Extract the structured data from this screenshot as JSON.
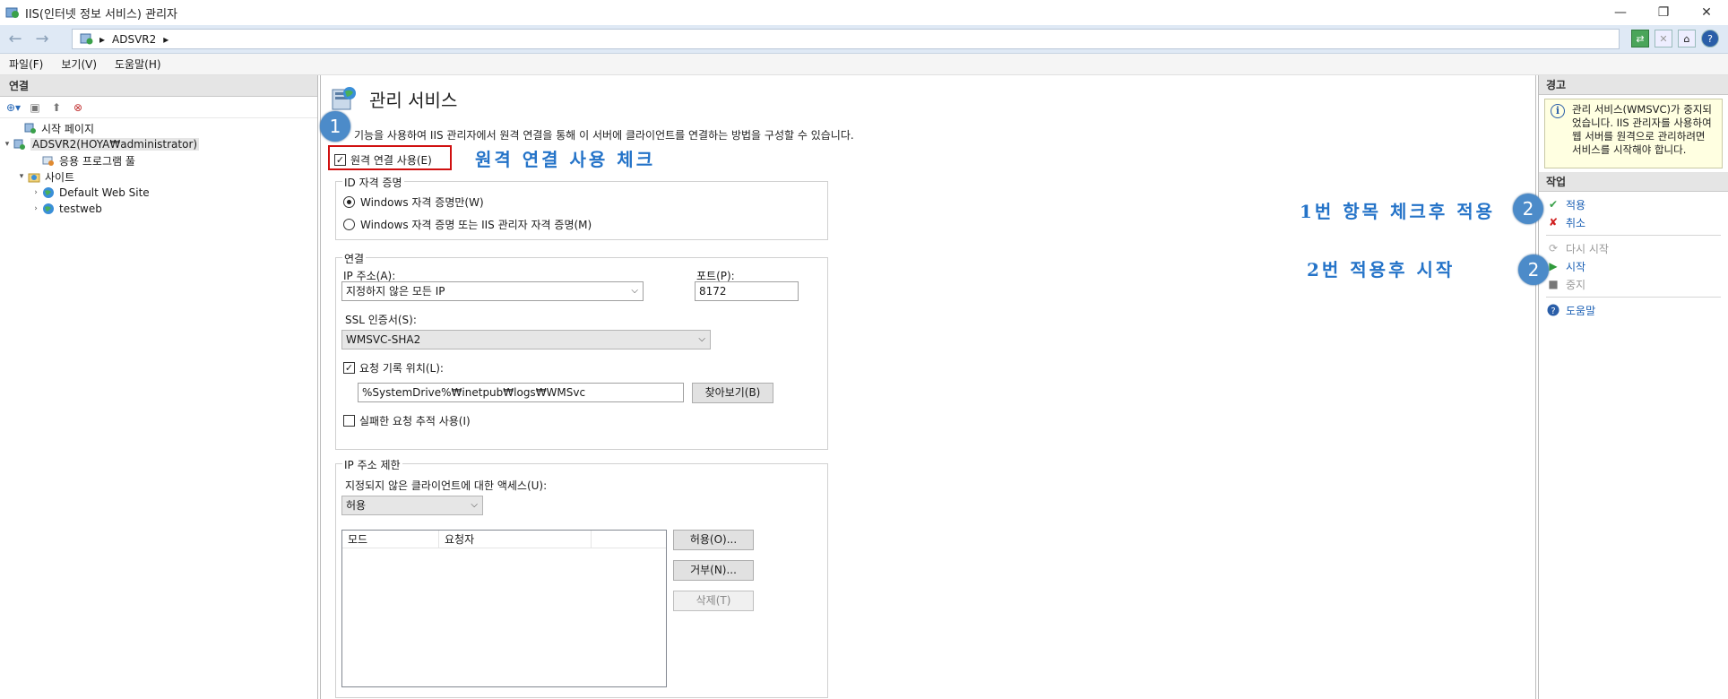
{
  "window": {
    "title": "IIS(인터넷 정보 서비스) 관리자",
    "min": "—",
    "max": "❐",
    "close": "✕"
  },
  "address": {
    "segments": [
      "ADSVR2"
    ],
    "back": "←",
    "forward": "→"
  },
  "menu": [
    "파일(F)",
    "보기(V)",
    "도움말(H)"
  ],
  "connections": {
    "header": "연결",
    "tree": [
      {
        "label": "시작 페이지",
        "indent": 1,
        "expander": "",
        "icon": "start-page-icon"
      },
      {
        "label": "ADSVR2(HOYA₩administrator)",
        "indent": 0,
        "expander": "▾",
        "icon": "server-icon",
        "selected": true
      },
      {
        "label": "응용 프로그램 풀",
        "indent": 2,
        "expander": "",
        "icon": "app-pool-icon"
      },
      {
        "label": "사이트",
        "indent": 1,
        "expander": "▾",
        "icon": "sites-folder-icon"
      },
      {
        "label": "Default Web Site",
        "indent": 2,
        "expander": "›",
        "icon": "globe-icon"
      },
      {
        "label": "testweb",
        "indent": 2,
        "expander": "›",
        "icon": "globe-icon"
      }
    ]
  },
  "feature": {
    "title": "관리 서비스",
    "description": "기능을 사용하여 IIS 관리자에서 원격 연결을 통해 이 서버에 클라이언트를 연결하는 방법을 구성할 수 있습니다.",
    "enable_remote_label": "원격 연결 사용(E)",
    "enable_remote_checked": true,
    "id_group": {
      "title": "ID 자격 증명",
      "option1": "Windows 자격 증명만(W)",
      "option2": "Windows 자격 증명 또는 IIS 관리자 자격 증명(M)",
      "selected": 1
    },
    "connection_group": {
      "title": "연결",
      "ip_label": "IP 주소(A):",
      "ip_value": "지정하지 않은 모든 IP",
      "port_label": "포트(P):",
      "port_value": "8172",
      "ssl_label": "SSL 인증서(S):",
      "ssl_value": "WMSVC-SHA2",
      "log_label": "요청 기록 위치(L):",
      "log_checked": true,
      "log_path": "%SystemDrive%₩inetpub₩logs₩WMSvc",
      "browse_label": "찾아보기(B)",
      "failed_trace_label": "실패한 요청 추적 사용(I)",
      "failed_trace_checked": false
    },
    "ip_restrict_group": {
      "title": "IP 주소 제한",
      "access_label": "지정되지 않은 클라이언트에 대한 액세스(U):",
      "access_value": "허용",
      "columns": [
        "모드",
        "요청자"
      ],
      "allow_btn": "허용(O)...",
      "deny_btn": "거부(N)...",
      "delete_btn": "삭제(T)"
    }
  },
  "annotations": {
    "badge1": "1",
    "badge2a": "2",
    "badge2b": "2",
    "note_enable": "원격 연결 사용 체크",
    "note_apply": "1번 항목 체크후 적용",
    "note_start": "2번 적용후 시작"
  },
  "actions": {
    "alert_header": "경고",
    "alert_text": "관리 서비스(WMSVC)가 중지되었습니다. IIS 관리자를 사용하여 웹 서버를 원격으로 관리하려면 서비스를 시작해야 합니다.",
    "actions_header": "작업",
    "apply": "적용",
    "cancel": "취소",
    "restart": "다시 시작",
    "start": "시작",
    "stop": "중지",
    "help": "도움말"
  },
  "colors": {
    "accent_link": "#1a5fb4",
    "annotation_blue": "#2473c8",
    "highlight_red": "#d01010",
    "badge_blue": "#4c8bc9",
    "alert_bg": "#ffffe1"
  }
}
